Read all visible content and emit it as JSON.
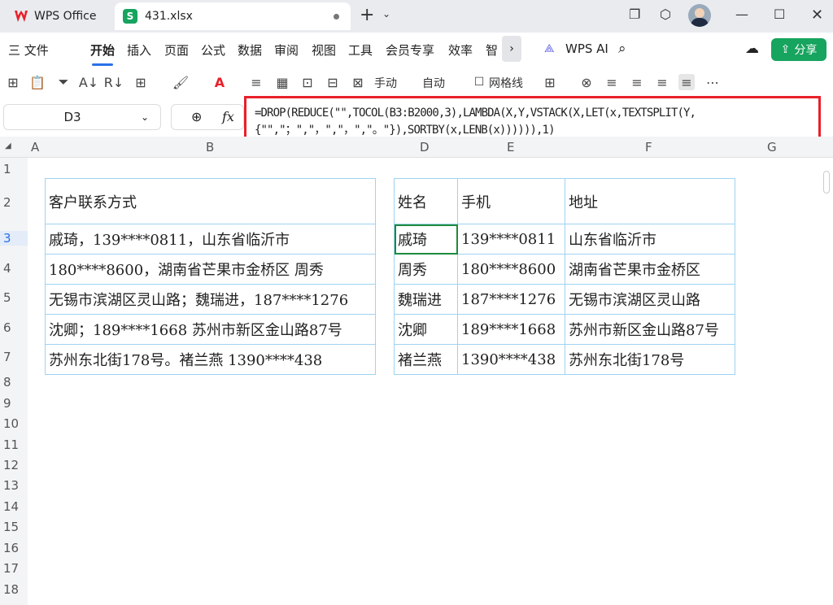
{
  "tabs": {
    "home": "WPS Office",
    "file": "431.xlsx"
  },
  "menu": {
    "items": [
      "三 文件",
      "开始",
      "插入",
      "页面",
      "公式",
      "数据",
      "审阅",
      "视图",
      "工具",
      "会员专享",
      "效率",
      "智"
    ],
    "ai": "WPS AI",
    "share": "分享"
  },
  "toolbar": {
    "manual": "手动",
    "auto": "自动",
    "gridlines": "网格线"
  },
  "formula_bar": {
    "cell": "D3",
    "fx": "fx",
    "formula": "=DROP(REDUCE(\"\",TOCOL(B3:B2000,3),LAMBDA(X,Y,VSTACK(X,LET(x,TEXTSPLIT(Y,{\"\",\"；\",\"，\",\"，\",\"。\"}),SORTBY(x,LENB(x)))))),1)"
  },
  "columns": [
    "A",
    "B",
    "D",
    "E",
    "F",
    "G"
  ],
  "rows": [
    "1",
    "2",
    "3",
    "4",
    "5",
    "6",
    "7",
    "8",
    "9",
    "10",
    "11",
    "12",
    "13",
    "14",
    "15",
    "16",
    "17",
    "18"
  ],
  "source_table": {
    "header": "客户联系方式",
    "rows": [
      "戚琦，139****0811，山东省临沂市",
      "180****8600，湖南省芒果市金桥区 周秀",
      "无锡市滨湖区灵山路；魏瑞进，187****1276",
      "沈卿；189****1668 苏州市新区金山路87号",
      "苏州东北街178号。褚兰燕 1390****438"
    ]
  },
  "result_table": {
    "headers": [
      "姓名",
      "手机",
      "地址"
    ],
    "rows": [
      [
        "戚琦",
        "139****0811",
        "山东省临沂市"
      ],
      [
        "周秀",
        "180****8600",
        "湖南省芒果市金桥区"
      ],
      [
        "魏瑞进",
        "187****1276",
        "无锡市滨湖区灵山路"
      ],
      [
        "沈卿",
        "189****1668",
        "苏州市新区金山路87号"
      ],
      [
        "褚兰燕",
        "1390****438",
        "苏州东北街178号"
      ]
    ]
  },
  "colors": {
    "accent": "#2a70e8",
    "share_green": "#16a45e",
    "highlight_red": "#e8202a",
    "table_border": "#9fd3f2"
  }
}
